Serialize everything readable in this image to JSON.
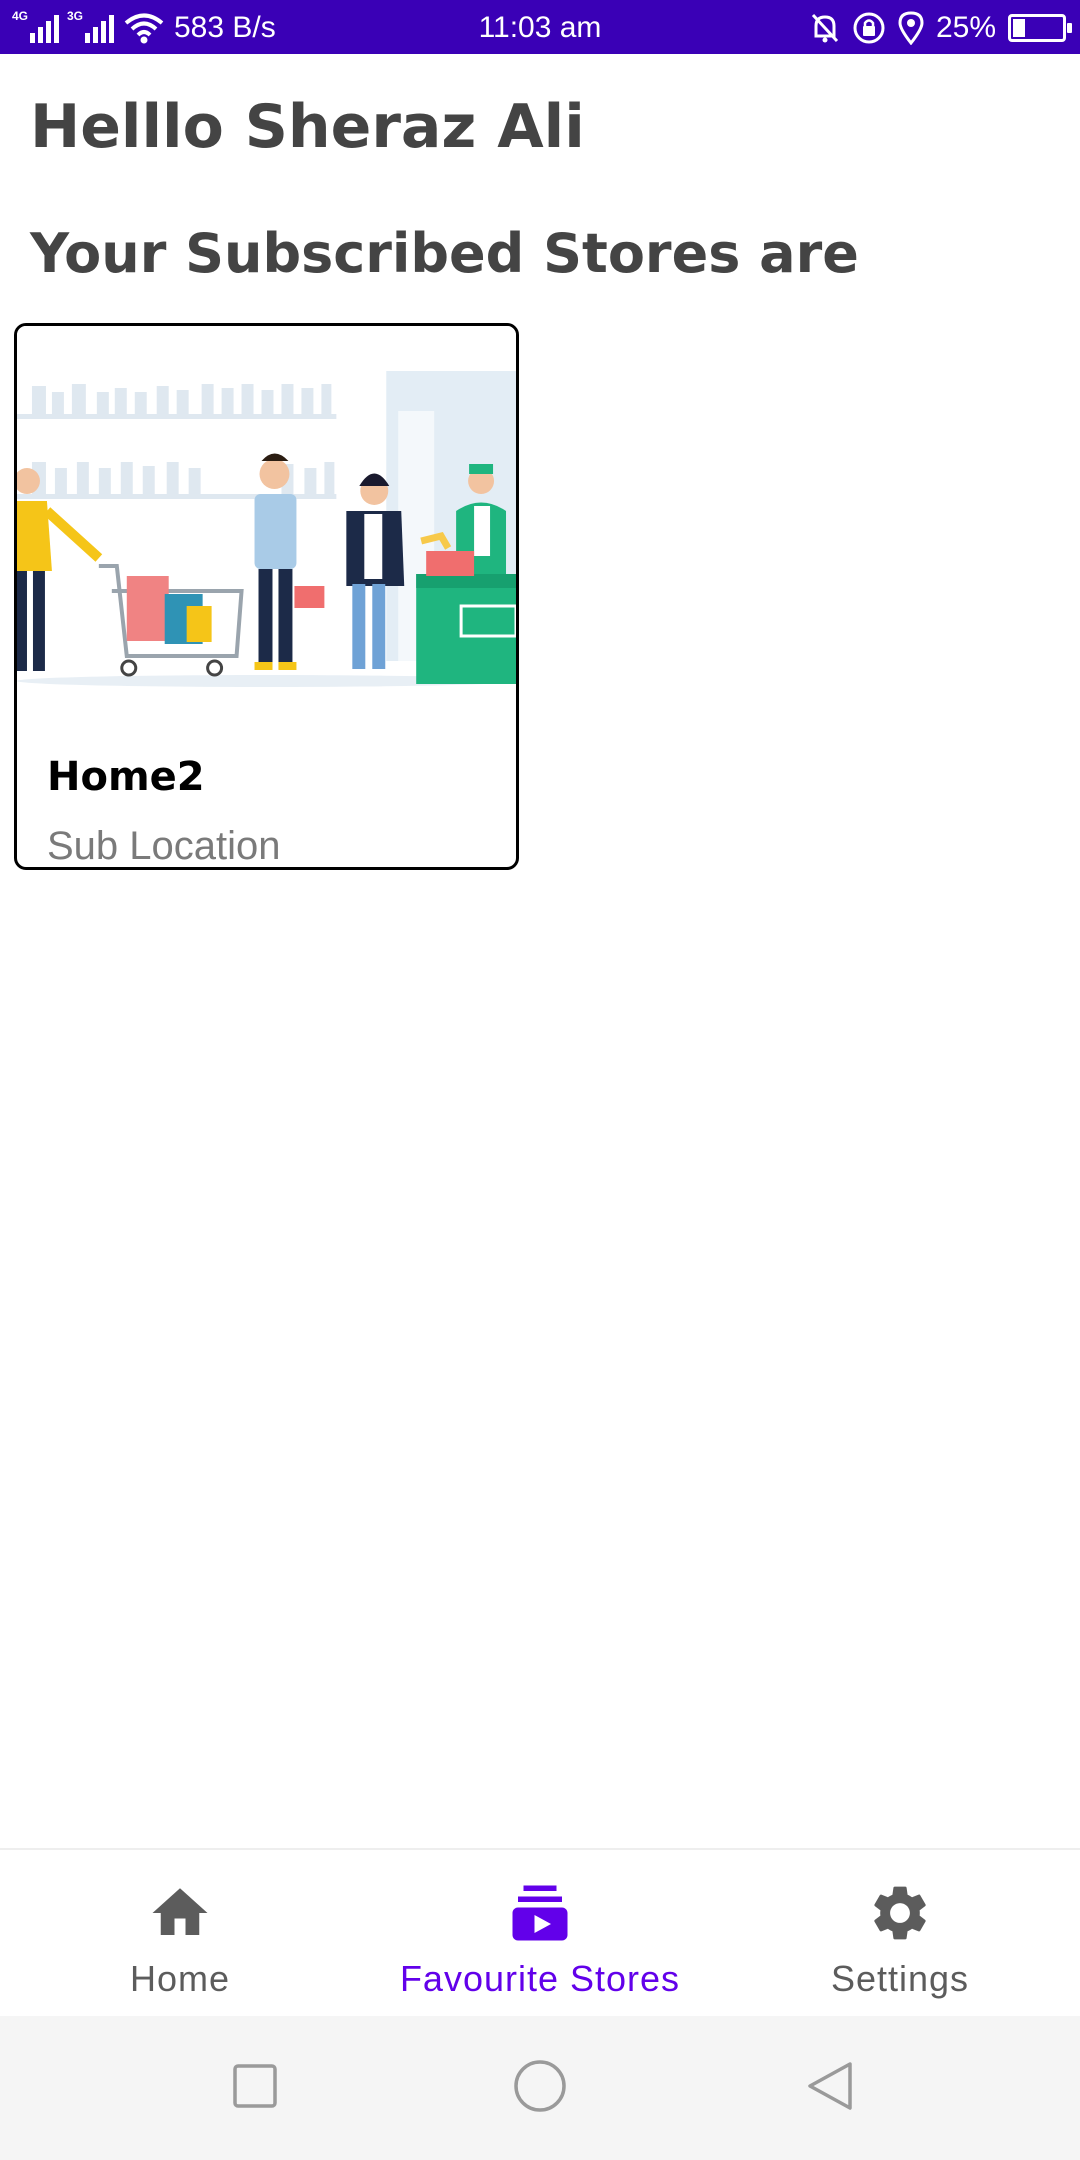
{
  "status_bar": {
    "net_tag_1": "4G",
    "net_tag_2": "3G",
    "speed": "583 B/s",
    "time": "11:03 am",
    "battery": "25%",
    "battery_level": 0.25
  },
  "greeting": "Helllo Sheraz Ali",
  "subtitle": "Your Subscribed Stores are",
  "stores": [
    {
      "name": "Home2",
      "location": "Sub Location",
      "image": "grocery-store-illustration"
    }
  ],
  "bottom_nav": {
    "items": [
      {
        "label": "Home",
        "icon": "home-icon",
        "active": false
      },
      {
        "label": "Favourite Stores",
        "icon": "subscriptions-icon",
        "active": true
      },
      {
        "label": "Settings",
        "icon": "gear-icon",
        "active": false
      }
    ]
  },
  "colors": {
    "status_bar": "#3a00b6",
    "accent": "#6200ea",
    "heading": "#444444",
    "inactive": "#5c5c5c"
  }
}
